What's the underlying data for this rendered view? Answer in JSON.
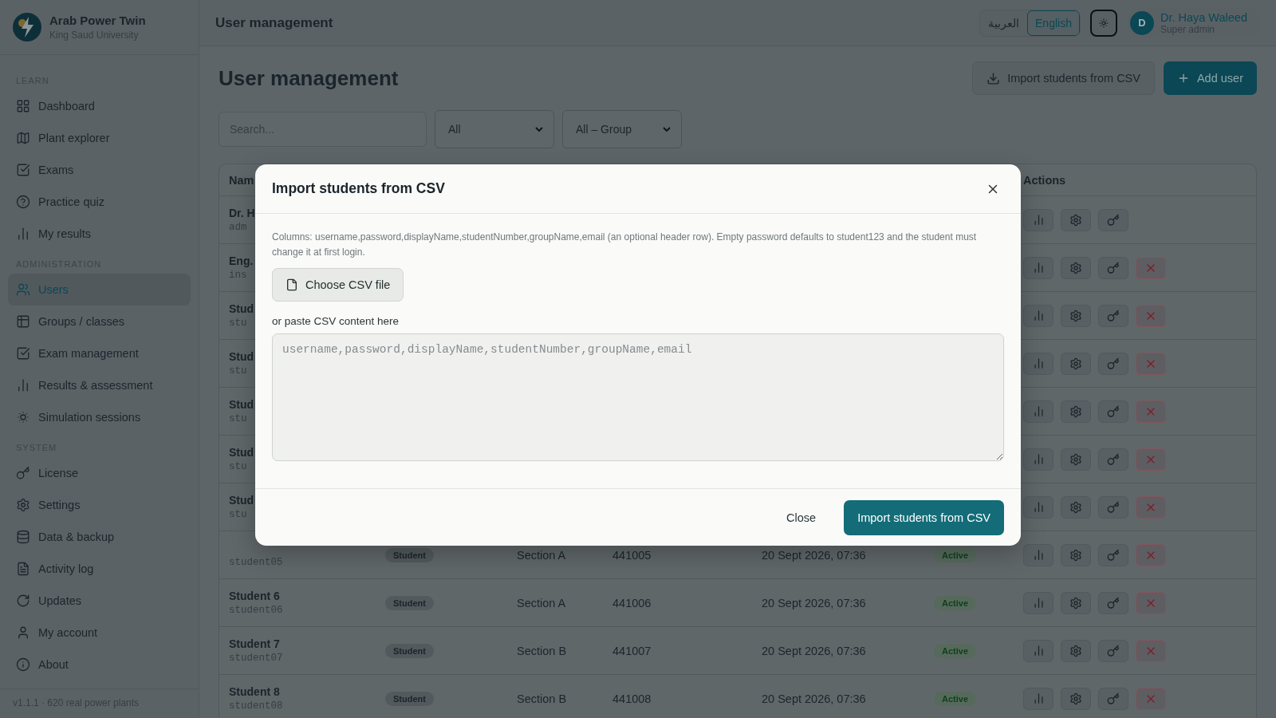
{
  "sidebar": {
    "brand": {
      "name": "Arab Power Twin",
      "subtitle": "King Saud University"
    },
    "sections": [
      {
        "label": "LEARN",
        "items": [
          {
            "label": "Dashboard",
            "selected": false
          },
          {
            "label": "Plant explorer",
            "selected": false
          },
          {
            "label": "Exams",
            "selected": false
          },
          {
            "label": "Practice quiz",
            "selected": false
          },
          {
            "label": "My results",
            "selected": false
          }
        ]
      },
      {
        "label": "ADMINISTRATION",
        "items": [
          {
            "label": "Users",
            "selected": true
          },
          {
            "label": "Groups / classes",
            "selected": false
          },
          {
            "label": "Exam management",
            "selected": false
          },
          {
            "label": "Results & assessment",
            "selected": false
          },
          {
            "label": "Simulation sessions",
            "selected": false
          }
        ]
      },
      {
        "label": "SYSTEM",
        "items": [
          {
            "label": "License",
            "selected": false
          },
          {
            "label": "Settings",
            "selected": false
          },
          {
            "label": "Data & backup",
            "selected": false
          },
          {
            "label": "Activity log",
            "selected": false
          },
          {
            "label": "Updates",
            "selected": false
          },
          {
            "label": "My account",
            "selected": false
          },
          {
            "label": "About",
            "selected": false
          }
        ]
      }
    ],
    "footer": "v1.1.1 · 620 real power plants"
  },
  "topbar": {
    "title": "User management",
    "languages": [
      {
        "label": "العربية",
        "selected": false
      },
      {
        "label": "English",
        "selected": true
      }
    ],
    "user": {
      "initial": "D",
      "name": "Dr. Haya Waleed",
      "role": "Super admin"
    }
  },
  "page": {
    "title": "User management",
    "buttons": [
      {
        "label": "Import students from CSV",
        "kind": "secondary"
      },
      {
        "label": "Add user",
        "kind": "primary"
      }
    ],
    "search": {
      "placeholder": "Search..."
    },
    "filters": [
      {
        "value": "All"
      },
      {
        "value": "All – Group"
      }
    ]
  },
  "table": {
    "columns": [
      "Nam",
      "Actions"
    ],
    "rows": [
      {
        "name": "Dr. H",
        "username": "adm",
        "deletable": false
      },
      {
        "name": "Eng.",
        "username": "ins",
        "deletable": true
      },
      {
        "name": "Stud",
        "username": "stu",
        "deletable": true
      },
      {
        "name": "Stud",
        "username": "stu",
        "deletable": true
      },
      {
        "name": "Stud",
        "username": "stu",
        "deletable": true
      },
      {
        "name": "Stud",
        "username": "stu",
        "deletable": true
      },
      {
        "name": "Stud",
        "username": "stu",
        "deletable": true
      },
      {
        "username": "student05",
        "role": "Student",
        "section": "Section A",
        "number": "441005",
        "created": "20 Sept 2026, 07:36",
        "status": "Active",
        "deletable": true
      },
      {
        "name": "Student 6",
        "username": "student06",
        "role": "Student",
        "section": "Section A",
        "number": "441006",
        "created": "20 Sept 2026, 07:36",
        "status": "Active",
        "deletable": true
      },
      {
        "name": "Student 7",
        "username": "student07",
        "role": "Student",
        "section": "Section B",
        "number": "441007",
        "created": "20 Sept 2026, 07:36",
        "status": "Active",
        "deletable": true
      },
      {
        "name": "Student 8",
        "username": "student08",
        "role": "Student",
        "section": "Section B",
        "number": "441008",
        "created": "20 Sept 2026, 07:36",
        "status": "Active",
        "deletable": true
      }
    ]
  },
  "modal": {
    "title": "Import students from CSV",
    "description": "Columns: username,password,displayName,studentNumber,groupName,email (an optional header row). Empty password defaults to student123 and the student must change it at first login.",
    "file_button": "Choose CSV file",
    "paste_label": "or paste CSV content here",
    "textarea": {
      "placeholder": "username,password,displayName,studentNumber,groupName,email"
    },
    "buttons": [
      {
        "label": "Close",
        "kind": "text"
      },
      {
        "label": "Import students from CSV",
        "kind": "primary"
      }
    ]
  }
}
